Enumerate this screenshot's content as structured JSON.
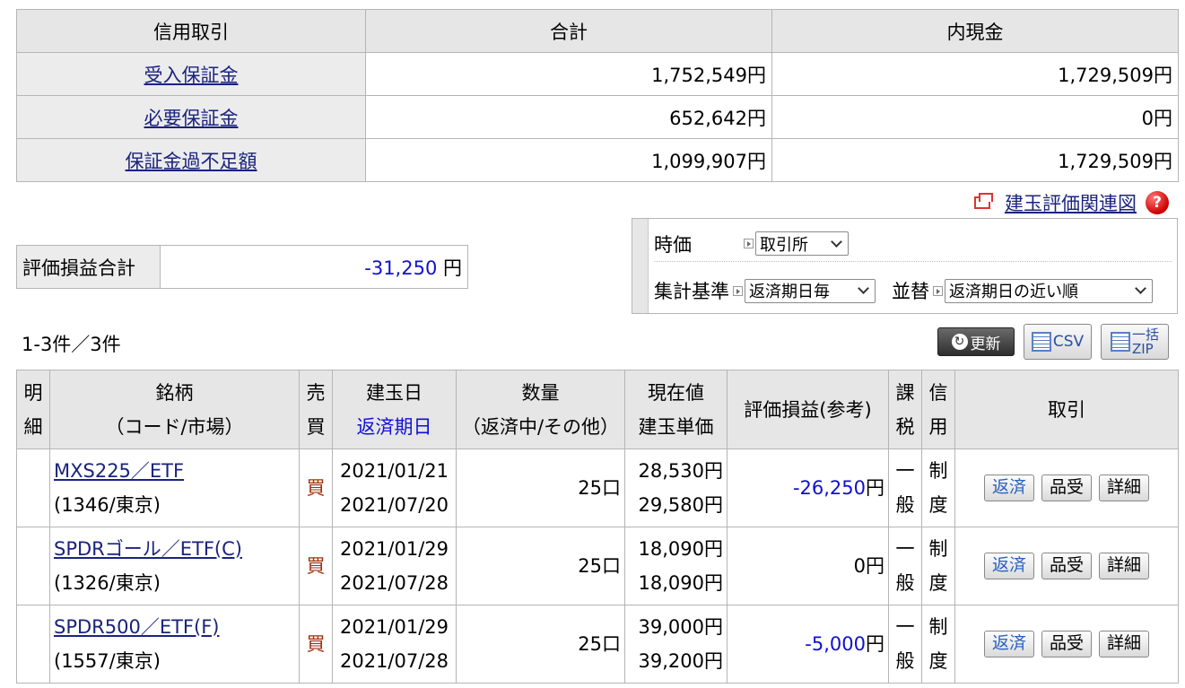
{
  "margin": {
    "headers": [
      "信用取引",
      "合計",
      "内現金"
    ],
    "rows": [
      {
        "label": "受入保証金",
        "total": "1,752,549円",
        "cash": "1,729,509円"
      },
      {
        "label": "必要保証金",
        "total": "652,642円",
        "cash": "0円"
      },
      {
        "label": "保証金過不足額",
        "total": "1,099,907円",
        "cash": "1,729,509円"
      }
    ]
  },
  "relation_link": {
    "label": "建玉評価関連図",
    "help": "?"
  },
  "profit_total": {
    "label": "評価損益合計",
    "value": "-31,250",
    "unit": "円"
  },
  "filters": {
    "price_label": "時価",
    "price_value": "取引所",
    "basis_label": "集計基準",
    "basis_value": "返済期日毎",
    "sort_label": "並替",
    "sort_value": "返済期日の近い順"
  },
  "count": "1-3件／3件",
  "toolbar": {
    "refresh": "更新",
    "csv": "CSV",
    "zip_top": "一括",
    "zip_bottom": "ZIP"
  },
  "table": {
    "headers": {
      "detail": [
        "明",
        "細"
      ],
      "brand": [
        "銘柄",
        "（コード/市場）"
      ],
      "side": [
        "売",
        "買"
      ],
      "date": [
        "建玉日",
        "返済期日"
      ],
      "qty": [
        "数量",
        "（返済中/その他）"
      ],
      "price": [
        "現在値",
        "建玉単価"
      ],
      "pl": "評価損益(参考)",
      "tax": [
        "課",
        "税"
      ],
      "credit": [
        "信",
        "用"
      ],
      "action": "取引"
    },
    "rows": [
      {
        "name": "MXS225／ETF",
        "code": "(1346/東京)",
        "side": "買",
        "open_date": "2021/01/21",
        "due_date": "2021/07/20",
        "qty": "25口",
        "current": "28,530円",
        "cost": "29,580円",
        "pl": "-26,250",
        "pl_unit": "円",
        "tax": [
          "一",
          "般"
        ],
        "credit": [
          "制",
          "度"
        ]
      },
      {
        "name": "SPDRゴール／ETF(C)",
        "code": "(1326/東京)",
        "side": "買",
        "open_date": "2021/01/29",
        "due_date": "2021/07/28",
        "qty": "25口",
        "current": "18,090円",
        "cost": "18,090円",
        "pl": "0",
        "pl_unit": "円",
        "tax": [
          "一",
          "般"
        ],
        "credit": [
          "制",
          "度"
        ]
      },
      {
        "name": "SPDR500／ETF(F)",
        "code": "(1557/東京)",
        "side": "買",
        "open_date": "2021/01/29",
        "due_date": "2021/07/28",
        "qty": "25口",
        "current": "39,000円",
        "cost": "39,200円",
        "pl": "-5,000",
        "pl_unit": "円",
        "tax": [
          "一",
          "般"
        ],
        "credit": [
          "制",
          "度"
        ]
      }
    ],
    "buttons": {
      "repay": "返済",
      "receive": "品受",
      "detail": "詳細"
    }
  }
}
